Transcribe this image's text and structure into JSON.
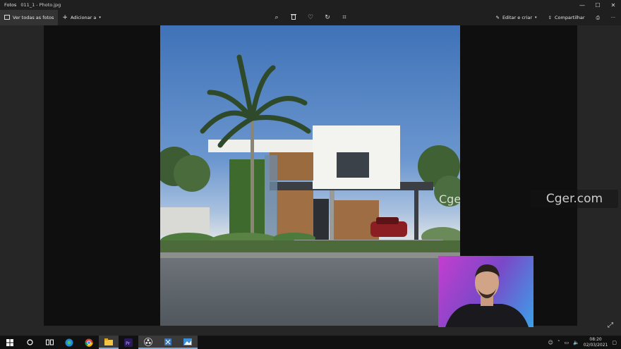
{
  "window": {
    "app_name": "Fotos",
    "file_name": "011_1 - Photo.jpg",
    "controls": {
      "minimize": "—",
      "maximize": "☐",
      "close": "✕"
    }
  },
  "toolbar": {
    "view_all": "Ver todas as fotos",
    "add_to": "Adicionar a",
    "center_icons": [
      "zoom-icon",
      "trash-icon",
      "heart-icon",
      "rotate-icon",
      "crop-icon"
    ],
    "edit_create": "Editar e criar",
    "share": "Compartilhar",
    "print_icon": "printer-icon",
    "more": "···"
  },
  "viewer": {
    "watermark_photo": "Cger.com",
    "watermark_overlay": "Cger.com",
    "expand_icon": "⤢"
  },
  "taskbar": {
    "items": [
      "windows-start-icon",
      "cortana-icon",
      "task-view-icon",
      "edge-icon",
      "chrome-icon",
      "file-explorer-icon",
      "premiere-pro-icon",
      "obs-icon",
      "snipping-tool-icon",
      "photos-icon"
    ],
    "time": "08:20",
    "date": "02/03/2021"
  },
  "colors": {
    "accent": "#7aa6d8",
    "background": "#1f1f1f",
    "stage": "#0f0f0f",
    "premiere": "#2a1a5e"
  }
}
